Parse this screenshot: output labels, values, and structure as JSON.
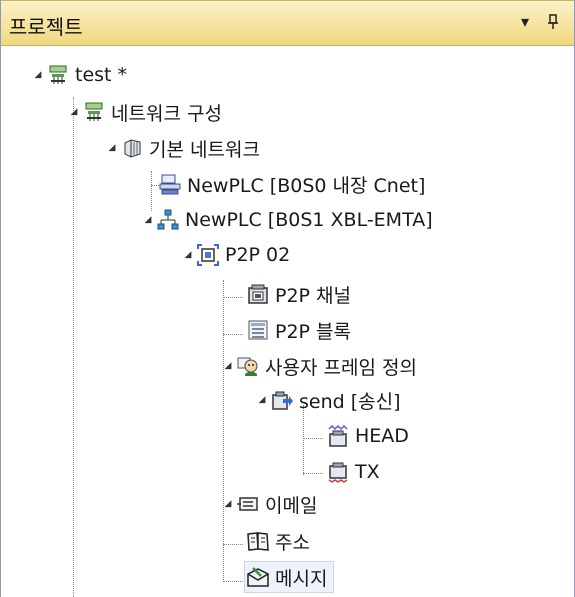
{
  "panel": {
    "title": "프로젝트",
    "dropdown_glyph": "▾",
    "pin_glyph": "⬇"
  },
  "tree": {
    "expand_glyph": "◢",
    "nodes": {
      "project": {
        "label": "test *",
        "icon": "network-icon"
      },
      "network_config": {
        "label": "네트워크 구성",
        "icon": "network-icon"
      },
      "basic_network": {
        "label": "기본 네트워크",
        "icon": "basic-network-icon"
      },
      "plc_cnet": {
        "label": "NewPLC [B0S0 내장 Cnet]",
        "icon": "serial-device-icon"
      },
      "plc_emta": {
        "label": "NewPLC [B0S1 XBL-EMTA]",
        "icon": "ethernet-tree-icon"
      },
      "p2p": {
        "label": "P2P 02",
        "icon": "p2p-icon"
      },
      "p2p_channel": {
        "label": "P2P 채널",
        "icon": "channel-icon"
      },
      "p2p_block": {
        "label": "P2P 블록",
        "icon": "block-list-icon"
      },
      "user_frame": {
        "label": "사용자 프레임 정의",
        "icon": "user-frame-icon"
      },
      "send": {
        "label": "send [송신]",
        "icon": "send-icon"
      },
      "head": {
        "label": "HEAD",
        "icon": "frame-head-icon"
      },
      "tx": {
        "label": "TX",
        "icon": "frame-tx-icon"
      },
      "email": {
        "label": "이메일",
        "icon": "email-icon"
      },
      "address": {
        "label": "주소",
        "icon": "address-book-icon"
      },
      "message": {
        "label": "메시지",
        "icon": "message-icon"
      }
    }
  }
}
